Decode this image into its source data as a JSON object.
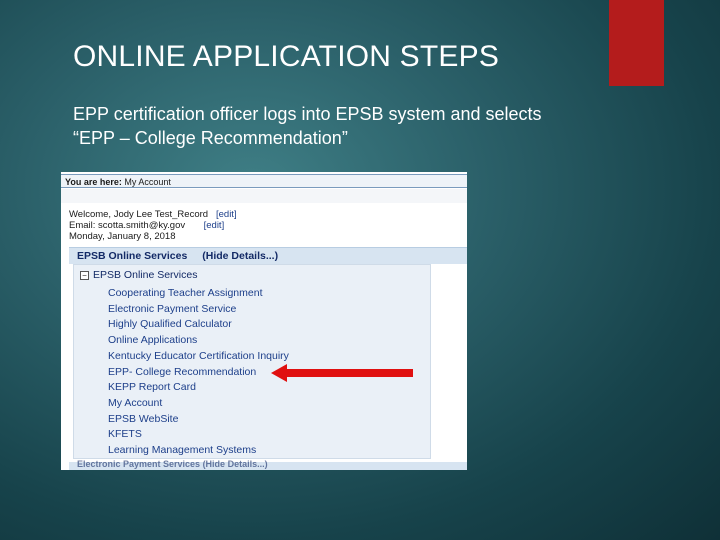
{
  "slide": {
    "title": "ONLINE APPLICATION STEPS",
    "body": "EPP certification officer logs into EPSB system and selects “EPP – College Recommendation”",
    "accent_color": "#b41c1c",
    "arrow_color": "#e01010"
  },
  "screenshot": {
    "breadcrumb_label": "You are here:",
    "breadcrumb_value": "My Account",
    "welcome_text": "Welcome, Jody Lee Test_Record",
    "email_text": "Email: scotta.smith@ky.gov",
    "edit_label": "[edit]",
    "date_text": "Monday, January 8, 2018",
    "section_title": "EPSB Online Services",
    "hide_details": "(Hide Details...)",
    "group_label": "EPSB Online Services",
    "links": [
      "Cooperating Teacher Assignment",
      "Electronic Payment Service",
      "Highly Qualified Calculator",
      "Online Applications",
      "Kentucky Educator Certification Inquiry",
      "EPP- College Recommendation",
      "KEPP Report Card",
      "My Account",
      "EPSB WebSite",
      "KFETS",
      "Learning Management Systems"
    ],
    "next_section": "Electronic Payment Services (Hide Details...)"
  }
}
